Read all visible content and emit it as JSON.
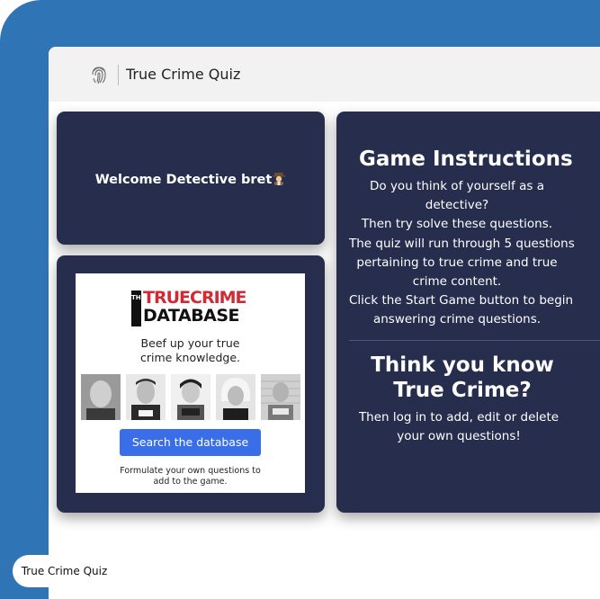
{
  "app": {
    "title": "True Crime Quiz"
  },
  "navbar": {
    "brand": "True Crime Quiz",
    "logo_icon": "fingerprint-icon"
  },
  "welcome": {
    "text": "Welcome Detective bret",
    "icon": "detective-icon"
  },
  "ad": {
    "logo_the": "THE",
    "logo_line1": "TRUECRIME",
    "logo_line2": "DATABASE",
    "tagline_line1": "Beef up your true",
    "tagline_line2": "crime knowledge.",
    "button_label": "Search the database",
    "footnote_line1": "Formulate your own questions to",
    "footnote_line2": "add to the game."
  },
  "instructions": {
    "title": "Game Instructions",
    "lines": [
      "Do you think of yourself as a",
      "detective?",
      "Then try solve these questions.",
      "The quiz will run through 5 questions",
      "pertaining to true crime and true",
      "crime content.",
      "Click the Start Game button to begin",
      "answering crime questions."
    ]
  },
  "know": {
    "title_line1": "Think you know",
    "title_line2": "True Crime?",
    "body_line1": "Then log in to add, edit or delete",
    "body_line2": "your own questions!"
  },
  "tab_pill": {
    "label": "True Crime Quiz"
  },
  "colors": {
    "frame": "#2f74b5",
    "card": "#262d4d",
    "button": "#3a6ee8",
    "brand_red": "#d22a33"
  }
}
